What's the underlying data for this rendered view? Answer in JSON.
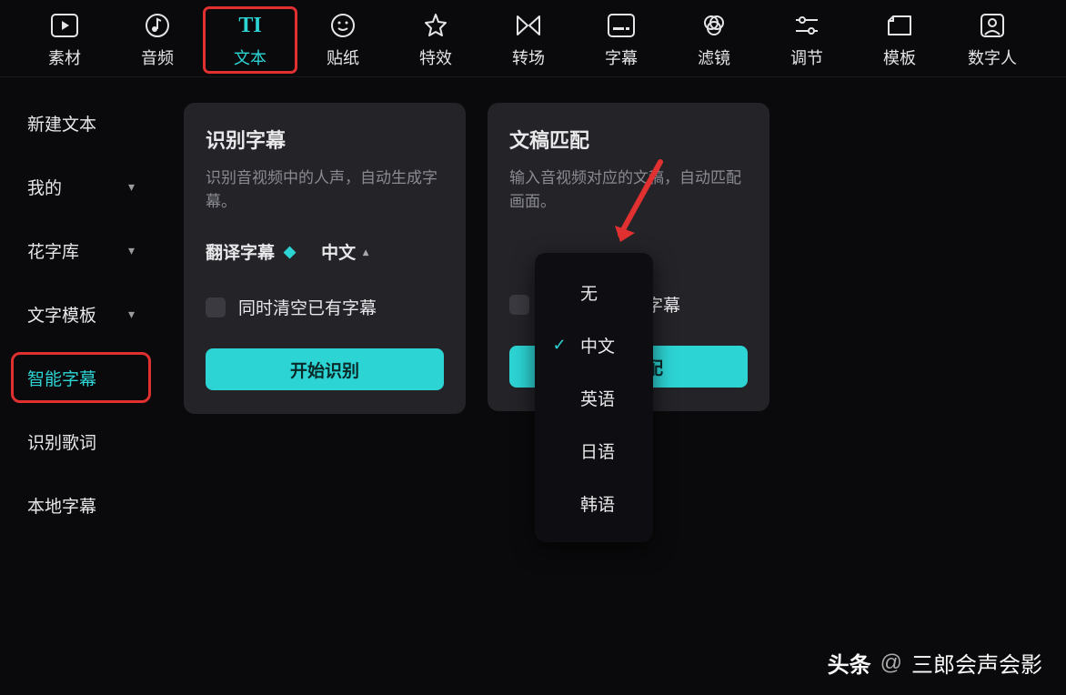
{
  "topnav": [
    {
      "label": "素材",
      "icon": "play"
    },
    {
      "label": "音频",
      "icon": "music"
    },
    {
      "label": "文本",
      "icon": "text",
      "active": true,
      "highlighted": true
    },
    {
      "label": "贴纸",
      "icon": "sticker"
    },
    {
      "label": "特效",
      "icon": "effect"
    },
    {
      "label": "转场",
      "icon": "transition"
    },
    {
      "label": "字幕",
      "icon": "subtitle"
    },
    {
      "label": "滤镜",
      "icon": "filter"
    },
    {
      "label": "调节",
      "icon": "adjust"
    },
    {
      "label": "模板",
      "icon": "template"
    },
    {
      "label": "数字人",
      "icon": "avatar"
    }
  ],
  "sidebar": [
    {
      "label": "新建文本",
      "dropdown": false
    },
    {
      "label": "我的",
      "dropdown": true
    },
    {
      "label": "花字库",
      "dropdown": true
    },
    {
      "label": "文字模板",
      "dropdown": true
    },
    {
      "label": "智能字幕",
      "dropdown": false,
      "selected": true,
      "highlighted": true
    },
    {
      "label": "识别歌词",
      "dropdown": false
    },
    {
      "label": "本地字幕",
      "dropdown": false
    }
  ],
  "cards": {
    "recognize": {
      "title": "识别字幕",
      "desc": "识别音视频中的人声，自动生成字幕。",
      "translate_label": "翻译字幕",
      "language_selected": "中文",
      "clear_label": "同时清空已有字幕",
      "button": "开始识别"
    },
    "match": {
      "title": "文稿匹配",
      "desc": "输入音视频对应的文稿，自动匹配画面。",
      "clear_label": "同时清空已有字幕",
      "button": "开始匹配"
    }
  },
  "dropdown": {
    "items": [
      "无",
      "中文",
      "英语",
      "日语",
      "韩语"
    ],
    "selected_index": 1
  },
  "watermark": {
    "brand": "头条",
    "author": "三郎会声会影"
  },
  "colors": {
    "accent": "#2dd4d4",
    "highlight": "#e03030"
  }
}
